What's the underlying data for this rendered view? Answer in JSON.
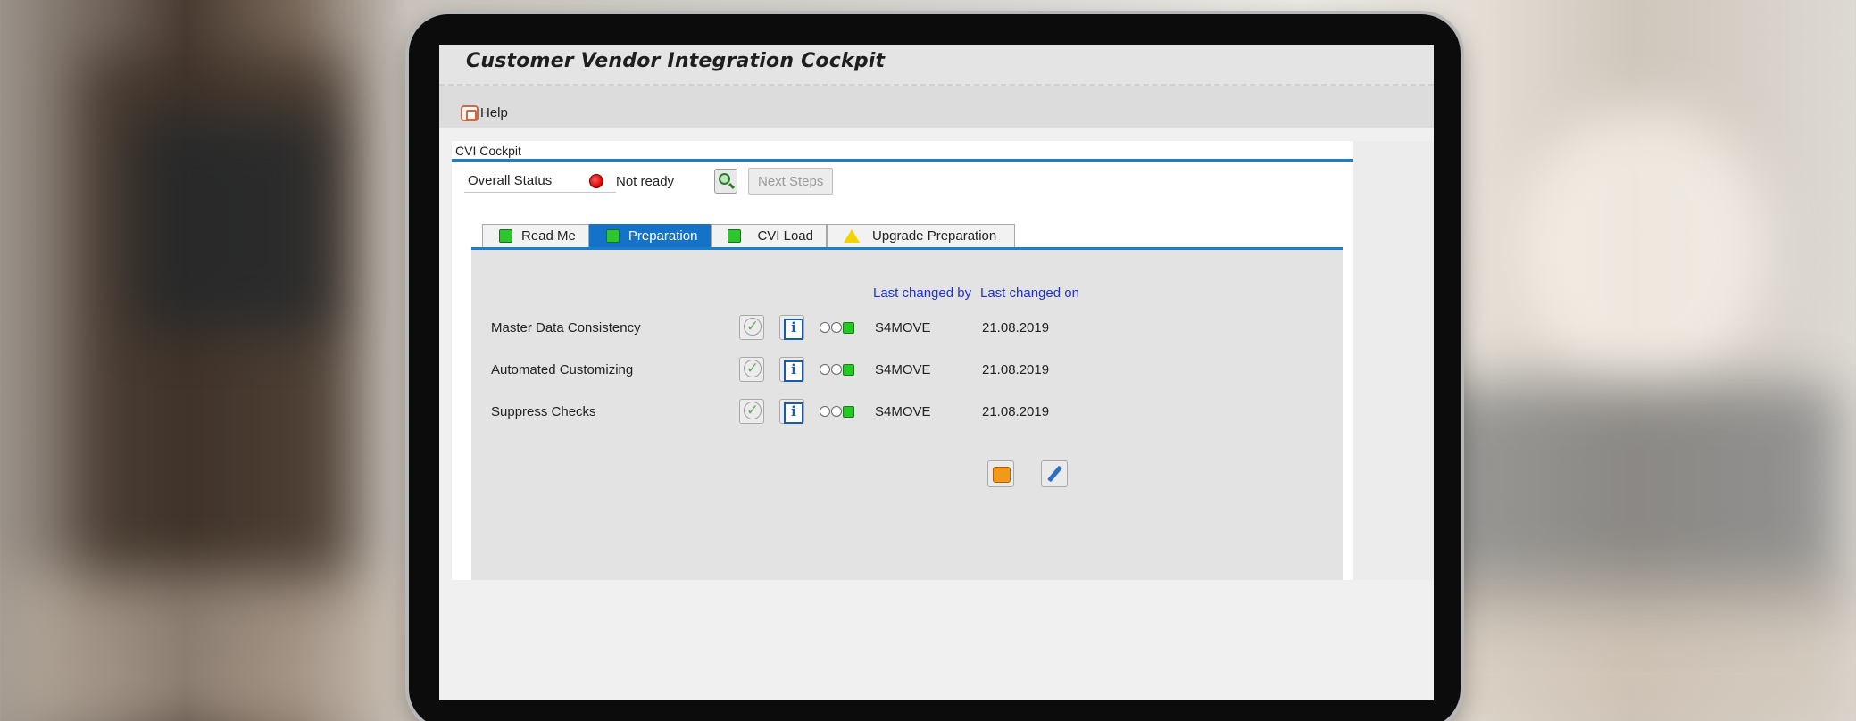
{
  "window": {
    "title": "Customer Vendor Integration Cockpit"
  },
  "toolbar": {
    "help_label": "Help"
  },
  "group": {
    "label": "CVI Cockpit"
  },
  "status": {
    "label": "Overall Status",
    "value": "Not ready",
    "indicator_color": "#d00000",
    "next_steps_label": "Next Steps"
  },
  "tabs": [
    {
      "label": "Read Me",
      "icon": "green-square-icon",
      "active": false
    },
    {
      "label": "Preparation",
      "icon": "green-square-icon",
      "active": true
    },
    {
      "label": "CVI Load",
      "icon": "green-square-icon",
      "active": false
    },
    {
      "label": "Upgrade Preparation",
      "icon": "warning-triangle-icon",
      "active": false
    }
  ],
  "table": {
    "headers": {
      "changed_by": "Last changed by",
      "changed_on": "Last changed on"
    },
    "rows": [
      {
        "label": "Master Data Consistency",
        "changed_by": "S4MOVE",
        "changed_on": "21.08.2019"
      },
      {
        "label": "Automated Customizing",
        "changed_by": "S4MOVE",
        "changed_on": "21.08.2019"
      },
      {
        "label": "Suppress Checks",
        "changed_by": "S4MOVE",
        "changed_on": "21.08.2019"
      }
    ]
  },
  "colors": {
    "accent": "#1473c8",
    "header_link": "#1e2fd8",
    "status_green": "#2ec62e",
    "warning": "#f3d400"
  }
}
